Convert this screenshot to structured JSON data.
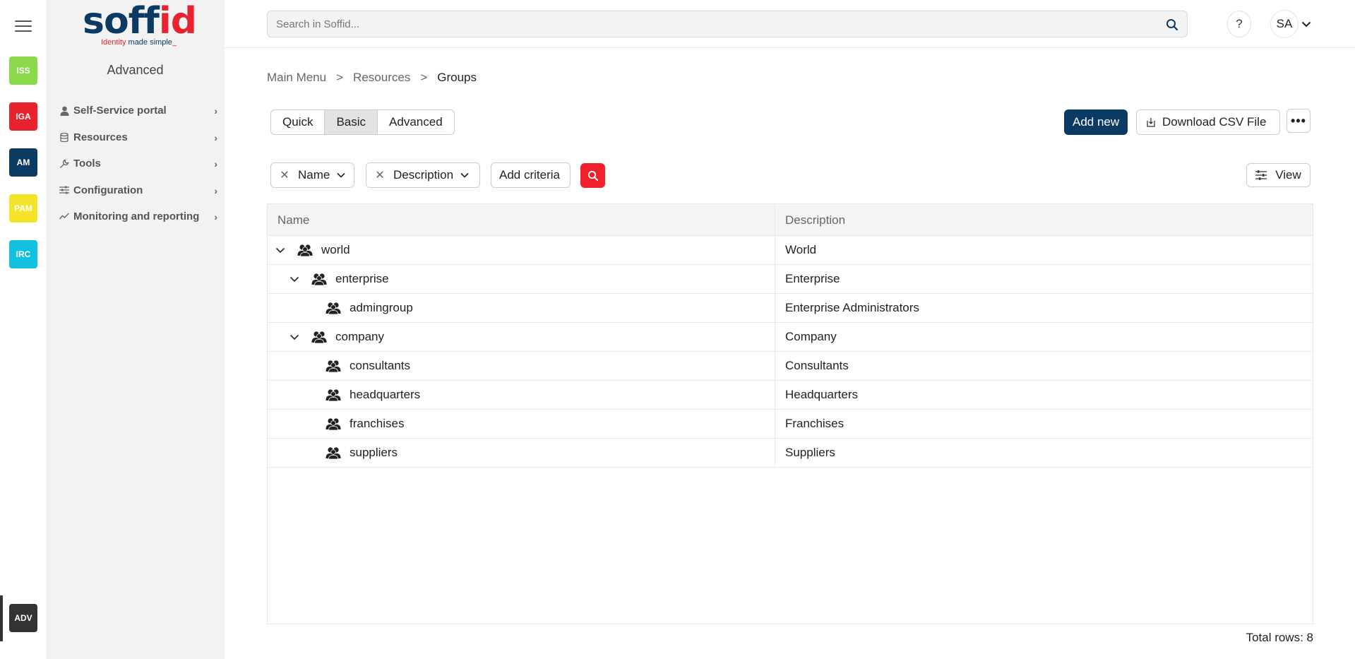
{
  "rail": {
    "apps": [
      {
        "label": "ISS",
        "color": "#8bd94a"
      },
      {
        "label": "IGA",
        "color": "#e8222f"
      },
      {
        "label": "AM",
        "color": "#0b3a63"
      },
      {
        "label": "PAM",
        "color": "#f5e22a"
      },
      {
        "label": "IRC",
        "color": "#12c0e0"
      }
    ],
    "active_app": {
      "label": "ADV",
      "color": "#333333"
    }
  },
  "logo": {
    "word_a": "soff",
    "word_b": "id",
    "tag_a": "Identity",
    "tag_b": " made simple",
    "tag_c": "_"
  },
  "sidebar": {
    "title": "Advanced",
    "items": [
      {
        "label": "Self-Service portal",
        "icon": "user-icon"
      },
      {
        "label": "Resources",
        "icon": "database-icon"
      },
      {
        "label": "Tools",
        "icon": "wrench-icon"
      },
      {
        "label": "Configuration",
        "icon": "sliders-icon"
      },
      {
        "label": "Monitoring and reporting",
        "icon": "chart-line-icon"
      }
    ]
  },
  "header": {
    "search_placeholder": "Search in Soffid...",
    "help_label": "?",
    "user_initials": "SA"
  },
  "breadcrumb": {
    "items": [
      "Main Menu",
      "Resources",
      "Groups"
    ],
    "separator": ">"
  },
  "modes": {
    "items": [
      "Quick",
      "Basic",
      "Advanced"
    ],
    "active": "Basic"
  },
  "toolbar": {
    "add_new": "Add new",
    "download_csv": "Download CSV File",
    "more": "•••"
  },
  "criteria": {
    "items": [
      "Name",
      "Description"
    ],
    "add_criteria": "Add criteria",
    "view": "View"
  },
  "table": {
    "columns": [
      "Name",
      "Description"
    ],
    "rows": [
      {
        "name": "world",
        "description": "World",
        "level": 0,
        "expanded": true
      },
      {
        "name": "enterprise",
        "description": "Enterprise",
        "level": 1,
        "expanded": true
      },
      {
        "name": "admingroup",
        "description": "Enterprise Administrators",
        "level": 2,
        "expanded": null
      },
      {
        "name": "company",
        "description": "Company",
        "level": 1,
        "expanded": true
      },
      {
        "name": "consultants",
        "description": "Consultants",
        "level": 2,
        "expanded": null
      },
      {
        "name": "headquarters",
        "description": "Headquarters",
        "level": 2,
        "expanded": null
      },
      {
        "name": "franchises",
        "description": "Franchises",
        "level": 2,
        "expanded": null
      },
      {
        "name": "suppliers",
        "description": "Suppliers",
        "level": 2,
        "expanded": null
      }
    ],
    "total_label": "Total rows: 8"
  }
}
